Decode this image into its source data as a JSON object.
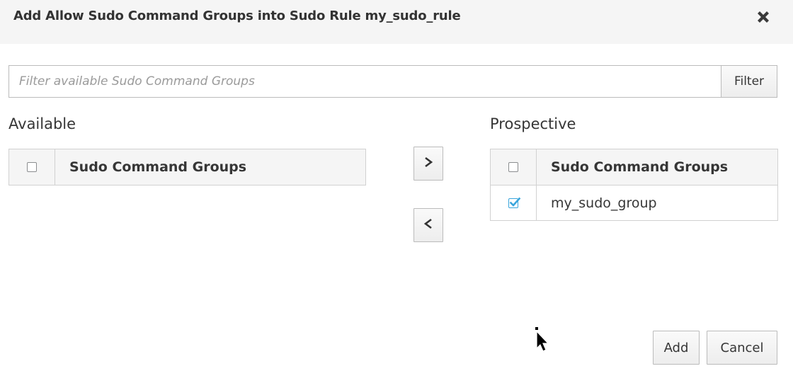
{
  "dialog": {
    "title": "Add Allow Sudo Command Groups into Sudo Rule my_sudo_rule",
    "close_icon": "close-x-icon"
  },
  "filter": {
    "placeholder": "Filter available Sudo Command Groups",
    "value": "",
    "button_label": "Filter"
  },
  "available": {
    "label": "Available",
    "column_header": "Sudo Command Groups",
    "header_checked": false,
    "rows": []
  },
  "prospective": {
    "label": "Prospective",
    "column_header": "Sudo Command Groups",
    "header_checked": false,
    "rows": [
      {
        "name": "my_sudo_group",
        "checked": true
      }
    ]
  },
  "move_buttons": {
    "add_icon": "chevron-right-icon",
    "remove_icon": "chevron-left-icon"
  },
  "footer": {
    "add_label": "Add",
    "cancel_label": "Cancel"
  },
  "colors": {
    "header_bg": "#f5f5f5",
    "border": "#d1d1d1",
    "check_accent": "#39a5dc"
  }
}
